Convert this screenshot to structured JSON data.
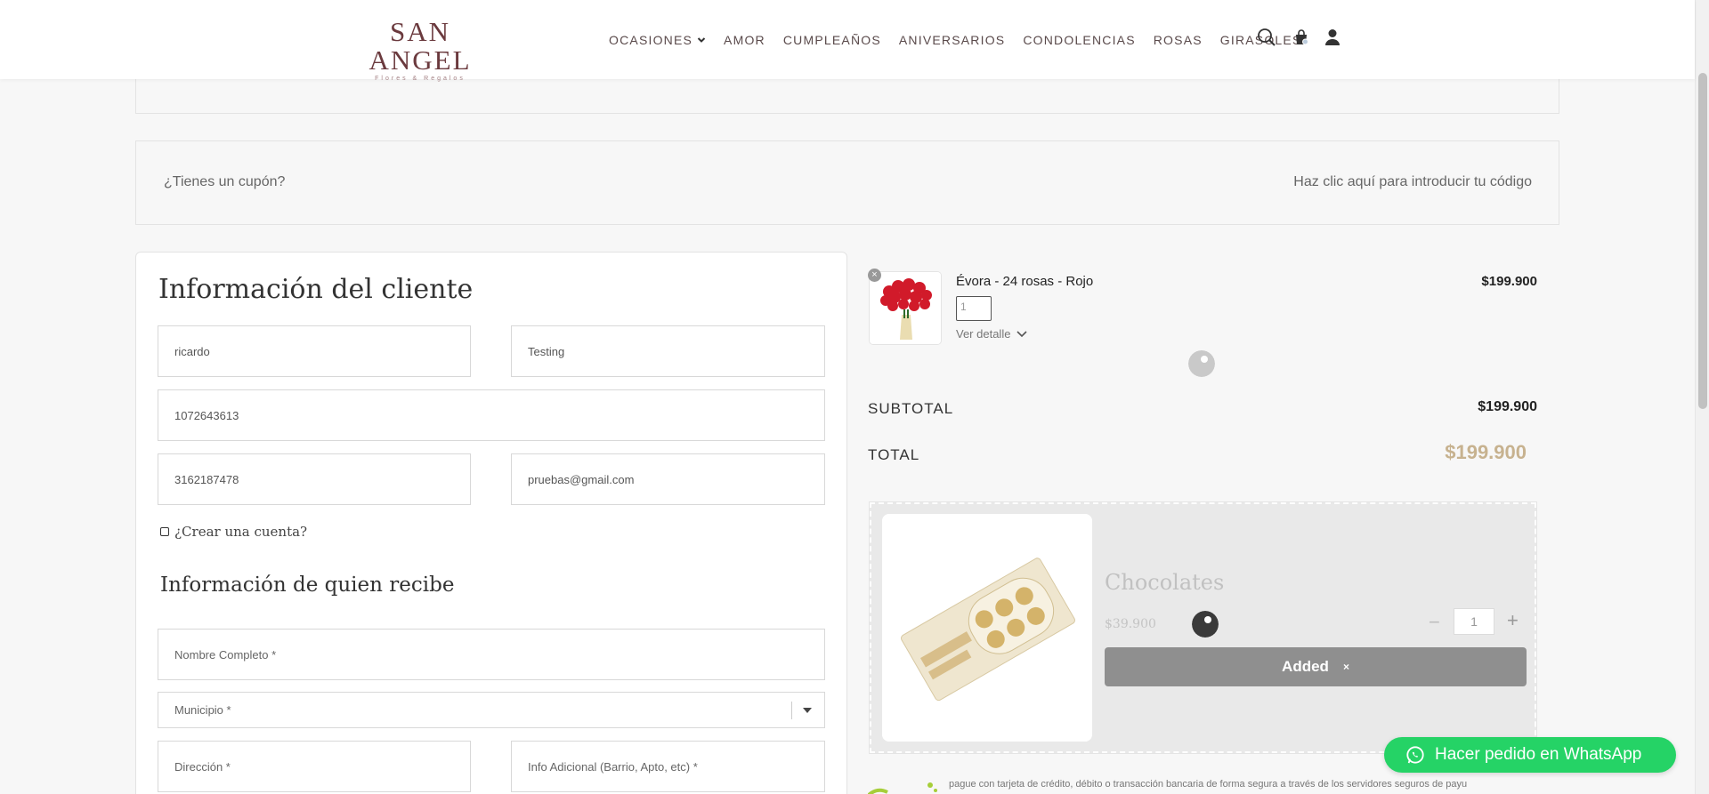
{
  "header": {
    "logo_main": "SAN ANGEL",
    "logo_sub": "Flores & Regalos",
    "nav": [
      {
        "label": "OCASIONES",
        "has_dropdown": true
      },
      {
        "label": "AMOR"
      },
      {
        "label": "CUMPLEAÑOS"
      },
      {
        "label": "ANIVERSARIOS"
      },
      {
        "label": "CONDOLENCIAS"
      },
      {
        "label": "ROSAS"
      },
      {
        "label": "GIRASOLES"
      }
    ],
    "icons": [
      "search-icon",
      "shopping-bag-icon",
      "user-icon"
    ]
  },
  "coupon": {
    "question": "¿Tienes un cupón?",
    "link": "Haz clic aquí para introducir tu código"
  },
  "customer": {
    "title": "Información del cliente",
    "first_name": "ricardo",
    "last_name": "Testing",
    "document": "1072643613",
    "phone": "3162187478",
    "email": "pruebas@gmail.com",
    "create_account": "¿Crear una cuenta?"
  },
  "recipient": {
    "title": "Información de quien recibe",
    "name_placeholder": "Nombre Completo *",
    "municipio_placeholder": "Municipio *",
    "address_placeholder": "Dirección *",
    "extra_placeholder": "Info Adicional (Barrio, Apto, etc) *"
  },
  "order": {
    "product_name": "Évora - 24 rosas - Rojo",
    "product_qty": "1",
    "product_detail": "Ver detalle",
    "product_price": "$199.900",
    "subtotal_label": "SUBTOTAL",
    "subtotal_value": "$199.900",
    "total_label": "TOTAL",
    "total_value": "$199.900",
    "total_color": "#c7b28f"
  },
  "upsell": {
    "title": "Chocolates",
    "price": "$39.900",
    "qty": "1",
    "minus": "−",
    "plus": "+",
    "button": "Added",
    "button_close": "×"
  },
  "payment_note": "pague con tarjeta de crédito, débito o transacción bancaria de forma segura a través de los servidores seguros de payu",
  "whatsapp": {
    "label": "Hacer pedido en WhatsApp",
    "color": "#25d366"
  }
}
